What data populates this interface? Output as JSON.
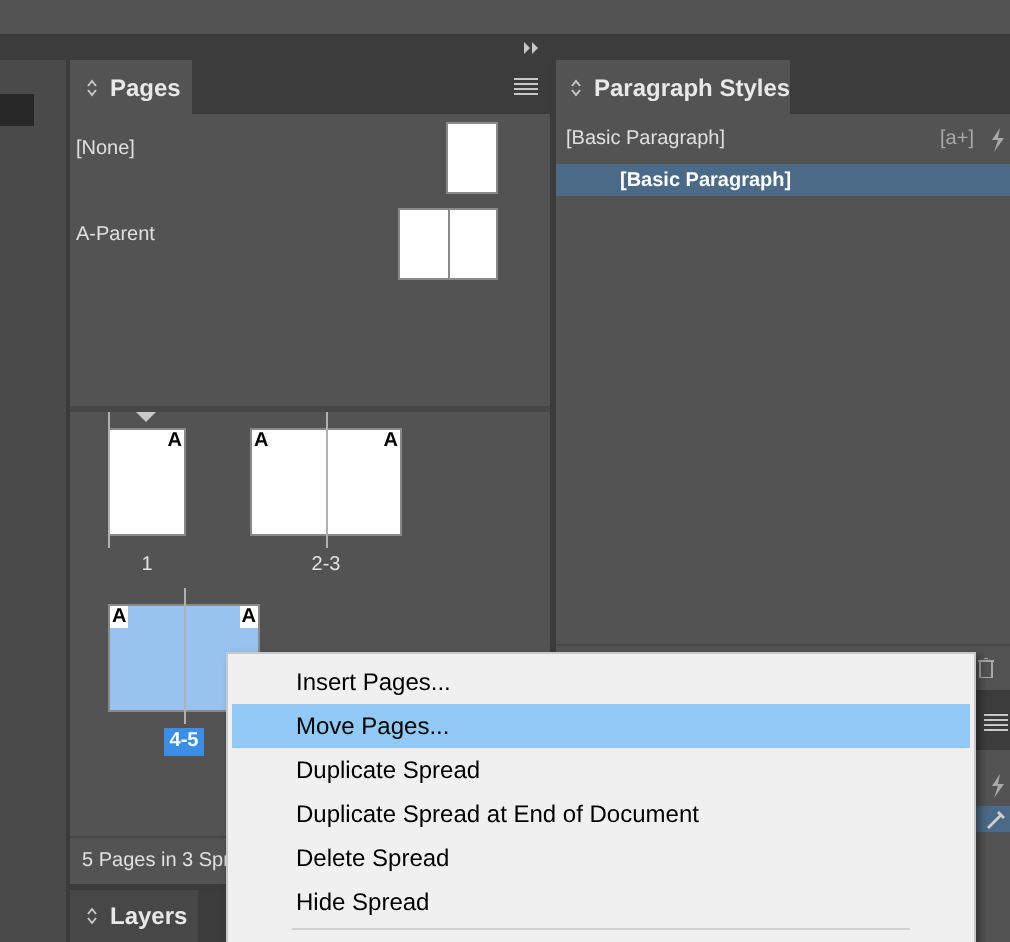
{
  "pages_panel": {
    "tab": "Pages",
    "parents": [
      {
        "name": "[None]",
        "kind": "single"
      },
      {
        "name": "A-Parent",
        "kind": "spread"
      }
    ],
    "spreads": [
      {
        "label": "1",
        "kind": "single",
        "selected": false,
        "markers": [
          "A"
        ]
      },
      {
        "label": "2-3",
        "kind": "spread",
        "selected": false,
        "markers": [
          "A",
          "A"
        ]
      },
      {
        "label": "4-5",
        "kind": "spread",
        "selected": true,
        "markers": [
          "A",
          "A"
        ]
      }
    ],
    "status": "5 Pages in 3 Spr"
  },
  "paragraph_styles_panel": {
    "tab": "Paragraph Styles",
    "current_style": "[Basic Paragraph]",
    "new_style_button": "[a+]",
    "styles": [
      {
        "name": "[Basic Paragraph]",
        "selected": true
      }
    ]
  },
  "layers_panel": {
    "tab": "Layers"
  },
  "context_menu": [
    {
      "label": "Insert Pages...",
      "selected": false
    },
    {
      "label": "Move Pages...",
      "selected": true
    },
    {
      "label": "Duplicate Spread",
      "selected": false
    },
    {
      "label": "Duplicate Spread at End of Document",
      "selected": false
    },
    {
      "label": "Delete Spread",
      "selected": false
    },
    {
      "label": "Hide Spread",
      "selected": false
    }
  ]
}
